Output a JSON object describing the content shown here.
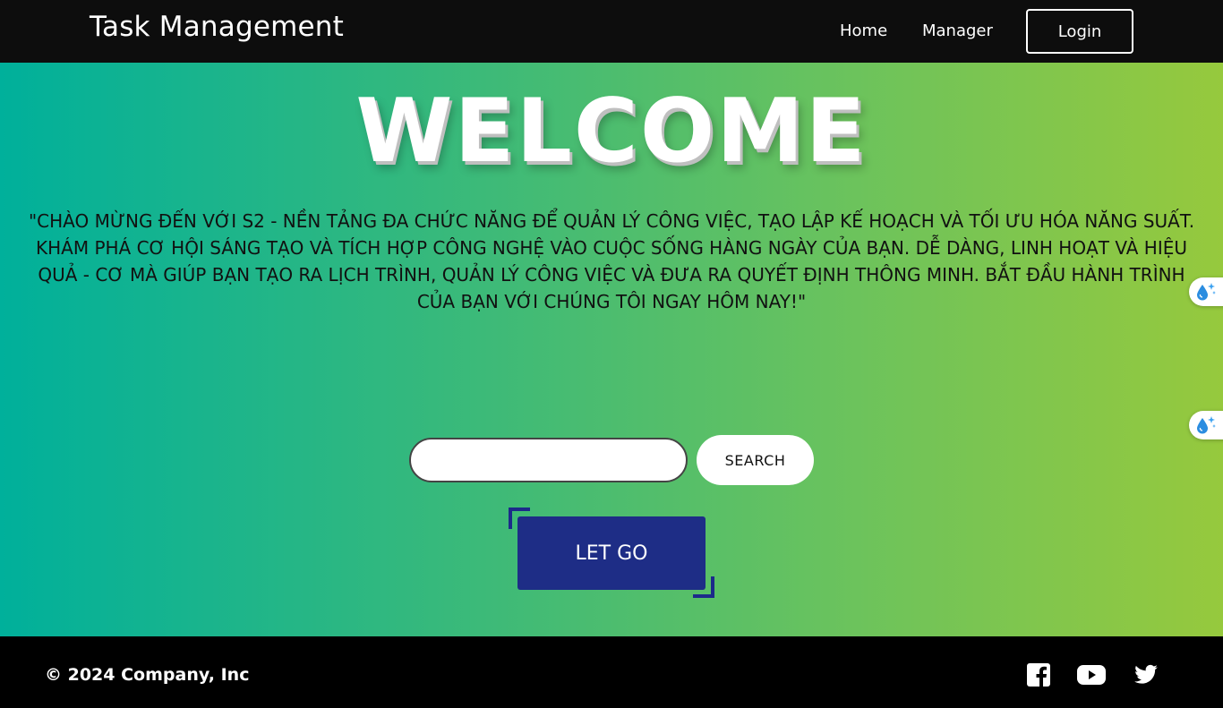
{
  "header": {
    "brand": "Task Management",
    "nav": {
      "home": "Home",
      "manager": "Manager"
    },
    "login_label": "Login"
  },
  "hero": {
    "title": "WELCOME",
    "tagline": "\"CHÀO MỪNG ĐẾN VỚI S2 - NỀN TẢNG ĐA CHỨC NĂNG ĐỂ QUẢN LÝ CÔNG VIỆC, TẠO LẬP KẾ HOẠCH VÀ TỐI ƯU HÓA NĂNG SUẤT. KHÁM PHÁ CƠ HỘI SÁNG TẠO VÀ TÍCH HỢP CÔNG NGHỆ VÀO CUỘC SỐNG HÀNG NGÀY CỦA BẠN. DỄ DÀNG, LINH HOẠT VÀ HIỆU QUẢ - CƠ MÀ GIÚP BẠN TẠO RA LỊCH TRÌNH, QUẢN LÝ CÔNG VIỆC VÀ ĐƯA RA QUYẾT ĐỊNH THÔNG MINH. BẮT ĐẦU HÀNH TRÌNH CỦA BẠN VỚI CHÚNG TÔI NGAY HÔM NAY!\"",
    "search": {
      "value": "",
      "placeholder": "",
      "button_label": "SEARCH"
    },
    "cta_label": "LET GO"
  },
  "side_tabs": [
    {
      "icon": "water-drop-sparkle-icon"
    },
    {
      "icon": "water-drop-sparkle-icon"
    }
  ],
  "footer": {
    "copyright": "© 2024 Company, Inc",
    "social": [
      "facebook-icon",
      "youtube-icon",
      "twitter-icon"
    ]
  },
  "colors": {
    "header_bg": "#0d0d0d",
    "gradient_start": "#00b09b",
    "gradient_end": "#96c93d",
    "cta_bg": "#1e2d86",
    "footer_bg": "#000000"
  }
}
